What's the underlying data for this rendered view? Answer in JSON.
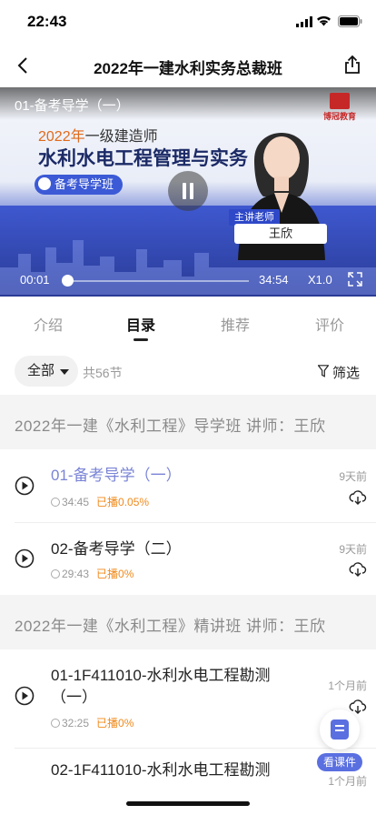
{
  "status_bar": {
    "time": "22:43"
  },
  "nav": {
    "title": "2022年一建水利实务总裁班"
  },
  "video": {
    "lesson_title": "01-备考导学（一）",
    "banner": {
      "year_highlight": "2022年",
      "year_rest": "一级建造师",
      "headline": "水利水电工程管理与实务",
      "badge": "备考导学班",
      "brand": "博冠教育",
      "teacher_label": "主讲老师",
      "teacher_name": "王欣"
    },
    "current_time": "00:01",
    "duration": "34:54",
    "speed": "X1.0",
    "progress": 0.0005
  },
  "tabs": [
    {
      "label": "介绍",
      "active": false
    },
    {
      "label": "目录",
      "active": true
    },
    {
      "label": "推荐",
      "active": false
    },
    {
      "label": "评价",
      "active": false
    }
  ],
  "filter": {
    "all_label": "全部",
    "count": "共56节",
    "filter_label": "筛选"
  },
  "sections": [
    {
      "title": "2022年一建《水利工程》导学班 讲师：王欣",
      "lessons": [
        {
          "title": "01-备考导学（一）",
          "duration": "34:45",
          "played": "已播0.05%",
          "ago": "9天前",
          "active": true
        },
        {
          "title": "02-备考导学（二）",
          "duration": "29:43",
          "played": "已播0%",
          "ago": "9天前",
          "active": false
        }
      ]
    },
    {
      "title": "2022年一建《水利工程》精讲班 讲师：王欣",
      "lessons": [
        {
          "title": "01-1F411010-水利水电工程勘测（一）",
          "duration": "32:25",
          "played": "已播0%",
          "ago": "1个月前",
          "active": false
        },
        {
          "title": "02-1F411010-水利水电工程勘测",
          "ago": "1个月前",
          "active": false
        }
      ]
    }
  ],
  "fab": {
    "label": "看课件"
  },
  "colors": {
    "accent": "#5a6fe0",
    "played": "#f08a1c",
    "active_lesson": "#7a84d6"
  }
}
